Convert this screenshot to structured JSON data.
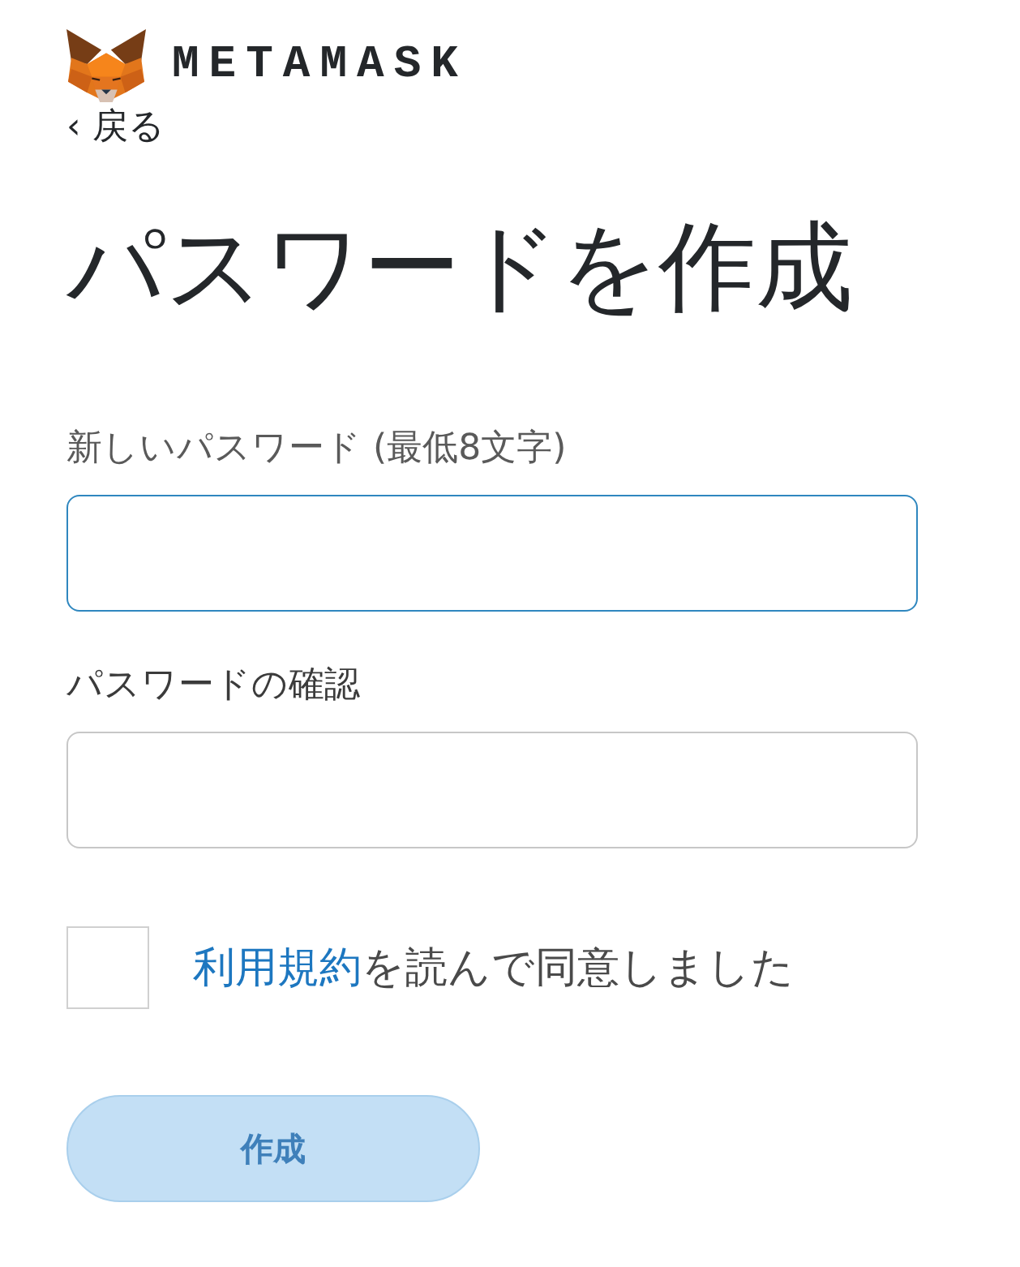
{
  "header": {
    "brand": "METAMASK",
    "back_link": "‹ 戻る"
  },
  "title": "パスワードを作成",
  "fields": [
    {
      "label": "新しいパスワード (最低8文字)",
      "focused": true
    },
    {
      "label": "パスワードの確認",
      "focused": false
    }
  ],
  "terms": {
    "checked": false,
    "link": "利用規約",
    "text": "を読んで同意しました"
  },
  "submit_button": {
    "label": "作成",
    "disabled": true
  }
}
